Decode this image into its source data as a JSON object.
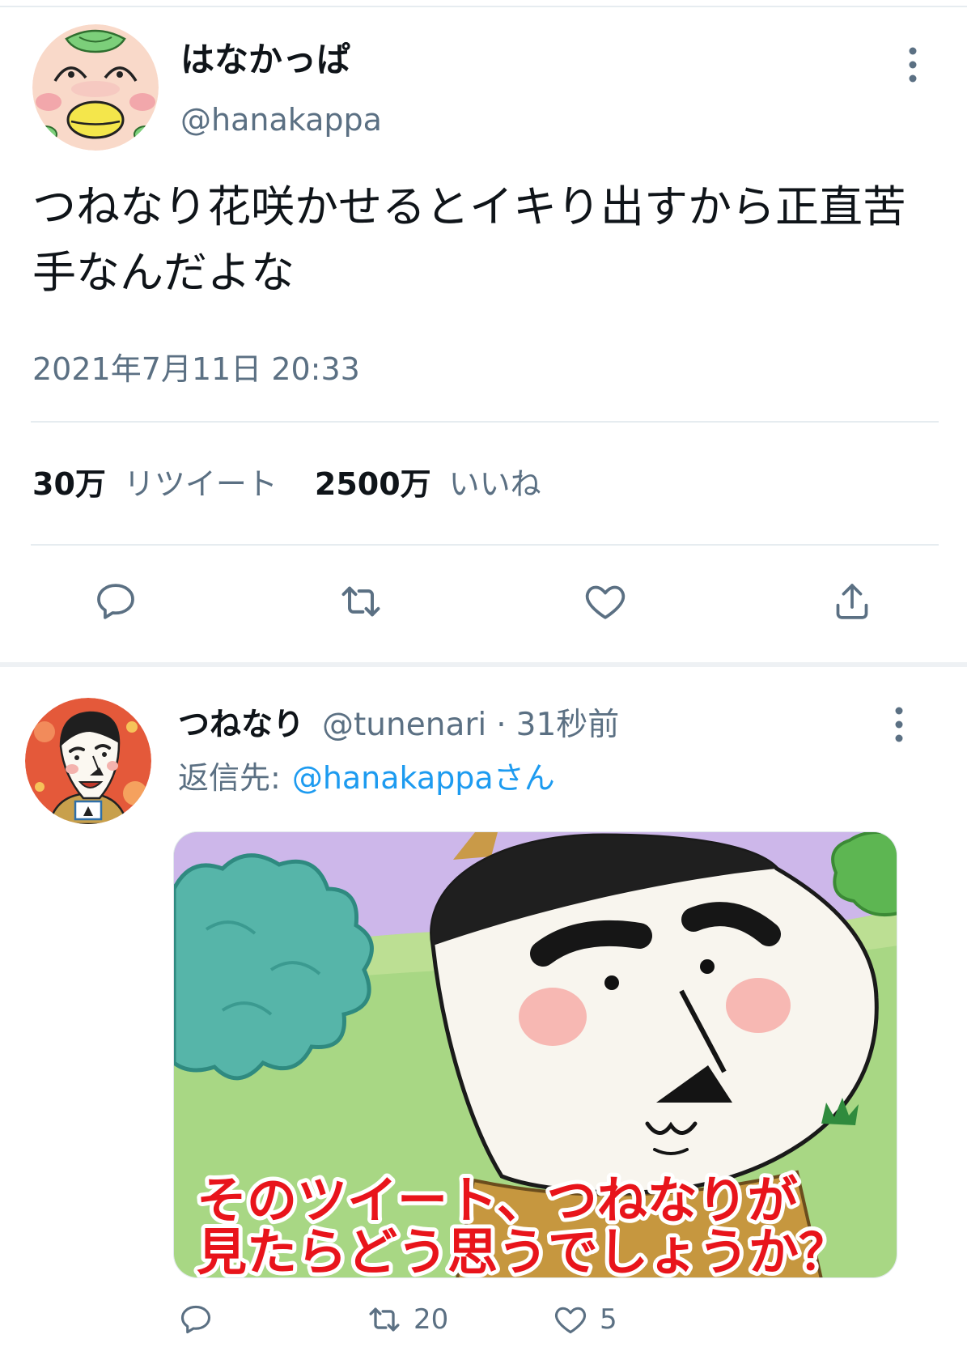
{
  "colors": {
    "text": "#0f1419",
    "secondary": "#5b7083",
    "link": "#1d9bf0",
    "divider": "#e6ecf0",
    "caption_red": "#e8141b"
  },
  "icons": {
    "more": "more-dots-icon",
    "reply": "reply-icon",
    "retweet": "retweet-icon",
    "like": "like-heart-icon",
    "share": "share-icon"
  },
  "main_tweet": {
    "author": {
      "name": "はなかっぱ",
      "handle": "@hanakappa"
    },
    "text": "つねなり花咲かせるとイキり出すから正直苦手なんだよな",
    "timestamp": "2021年7月11日 20:33",
    "stats": {
      "retweets_count": "30万",
      "retweets_label": "リツイート",
      "likes_count": "2500万",
      "likes_label": "いいね"
    }
  },
  "reply_tweet": {
    "author": {
      "name": "つねなり",
      "handle": "@tunenari"
    },
    "separator": "·",
    "time": "31秒前",
    "reply_to_prefix": "返信先:",
    "reply_to_handle": "@hanakappaさん",
    "image": {
      "caption_lines": [
        "そのツイート、つねなりが",
        "見たらどう思うでしょうか？"
      ]
    },
    "retweet_count": "20",
    "like_count": "5"
  }
}
